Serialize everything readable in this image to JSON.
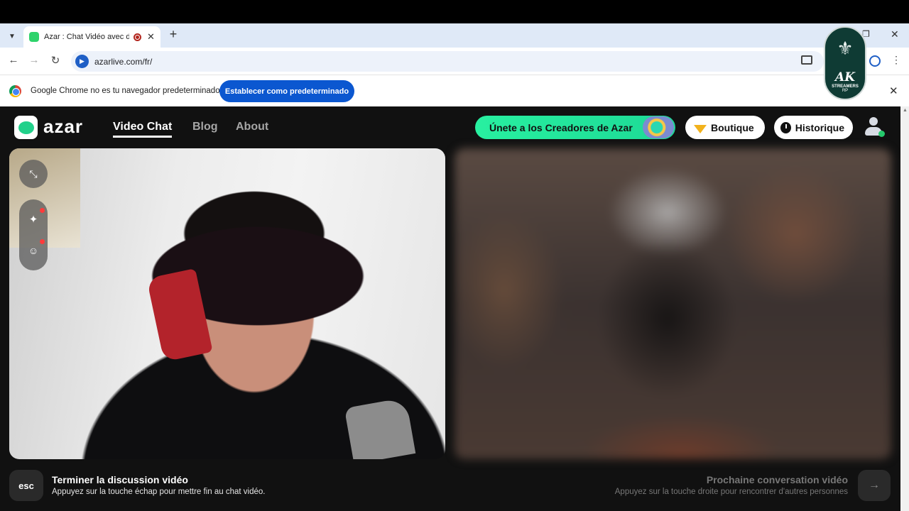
{
  "browser": {
    "tab_title": "Azar : Chat Vidéo avec de n",
    "url": "azarlive.com/fr/",
    "infobar_text": "Google Chrome no es tu navegador predeterminado",
    "infobar_button": "Establecer como predeterminado"
  },
  "watermark": {
    "main": "AK",
    "sub": "STREAMERS",
    "sub2": "RP"
  },
  "site": {
    "logo_text": "azar",
    "nav": [
      "Video Chat",
      "Blog",
      "About"
    ],
    "creators_button": "Únete a los Creadores de Azar",
    "boutique_button": "Boutique",
    "history_button": "Historique"
  },
  "footer": {
    "esc_label": "esc",
    "end_title": "Terminer la discussion vidéo",
    "end_hint": "Appuyez sur la touche échap pour mettre fin au chat vidéo.",
    "next_title": "Prochaine conversation vidéo",
    "next_hint": "Appuyez sur la touche droite pour rencontrer d'autres personnes"
  },
  "colors": {
    "accent": "#22d18b",
    "chrome_blue": "#0b57d0",
    "background": "#111111"
  }
}
